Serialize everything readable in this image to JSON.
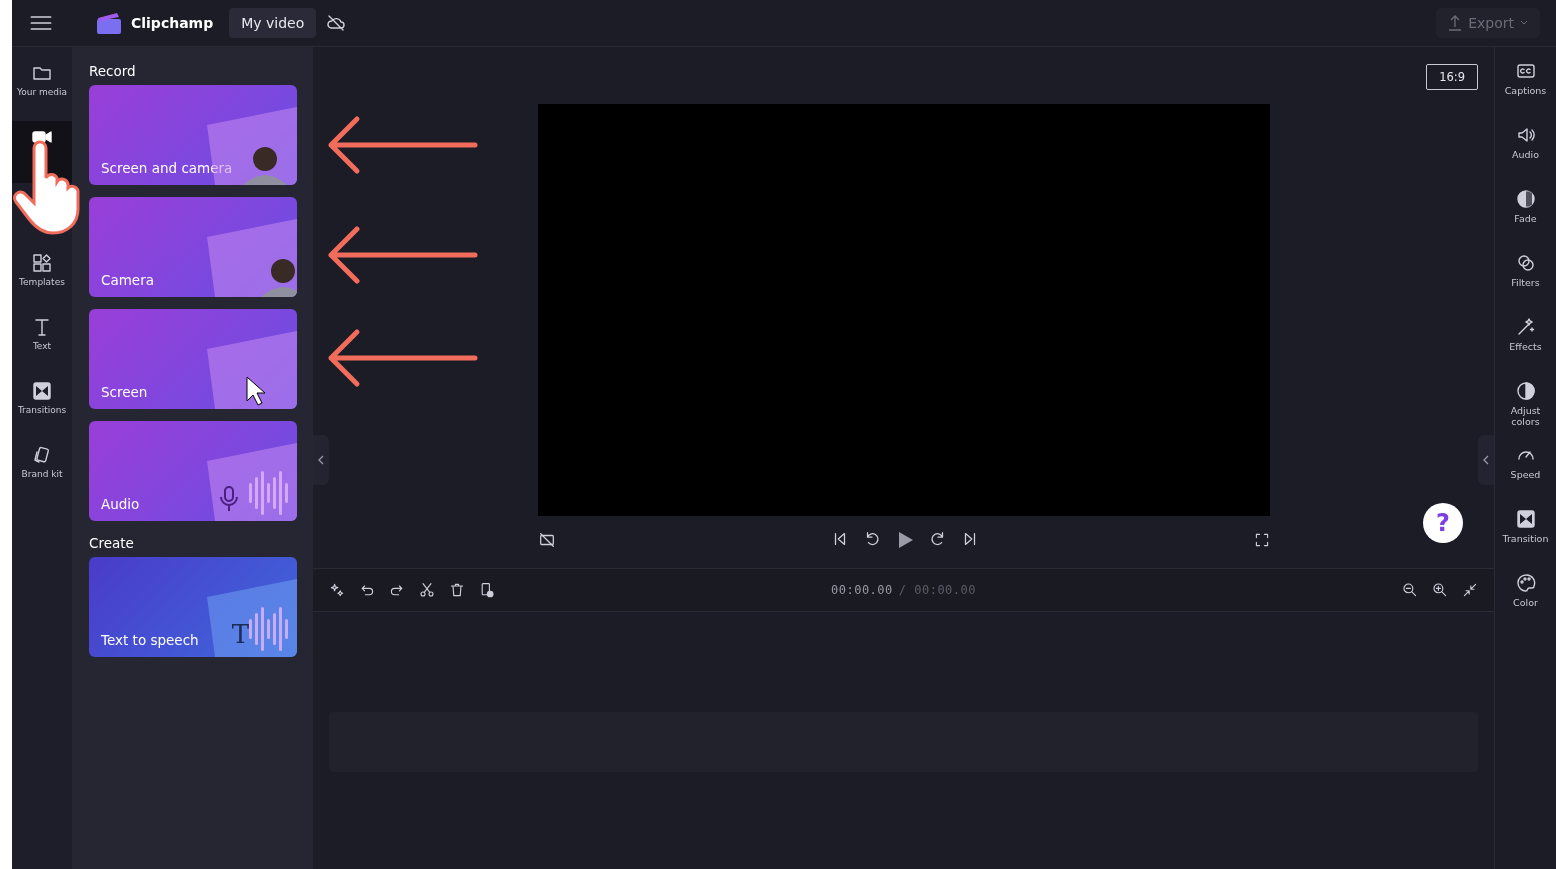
{
  "topbar": {
    "app_name": "Clipchamp",
    "project_title": "My video",
    "export_label": "Export",
    "export_disabled": true
  },
  "nav": [
    {
      "label": "Your media",
      "selected": false
    },
    {
      "selected": true
    },
    {
      "label": "Templates",
      "selected": false
    },
    {
      "label": "Text",
      "selected": false
    },
    {
      "label": "Transitions",
      "selected": false
    },
    {
      "label": "Brand kit",
      "selected": false
    }
  ],
  "panel": {
    "sections": [
      {
        "title": "Record",
        "cards": [
          {
            "label": "Screen and camera",
            "kind": "screen_camera"
          },
          {
            "label": "Camera",
            "kind": "camera"
          },
          {
            "label": "Screen",
            "kind": "screen"
          },
          {
            "label": "Audio",
            "kind": "audio"
          }
        ]
      },
      {
        "title": "Create",
        "cards": [
          {
            "label": "Text to speech",
            "kind": "tts",
            "glyph": "T"
          }
        ]
      }
    ]
  },
  "preview": {
    "aspect": "16:9"
  },
  "timeline": {
    "current": "00:00.00",
    "total": "/ 00:00.00"
  },
  "help": "?",
  "annotations": [
    {
      "kind": "arrow"
    },
    {
      "kind": "arrow"
    },
    {
      "kind": "arrow"
    }
  ],
  "right_bar": [
    {
      "label": "Captions"
    },
    {
      "label": "Audio"
    },
    {
      "label": "Fade"
    },
    {
      "label": "Filters"
    },
    {
      "label": "Effects"
    },
    {
      "label": "Adjust colors"
    },
    {
      "label": "Speed"
    },
    {
      "label": "Transition"
    },
    {
      "label": "Color"
    }
  ]
}
